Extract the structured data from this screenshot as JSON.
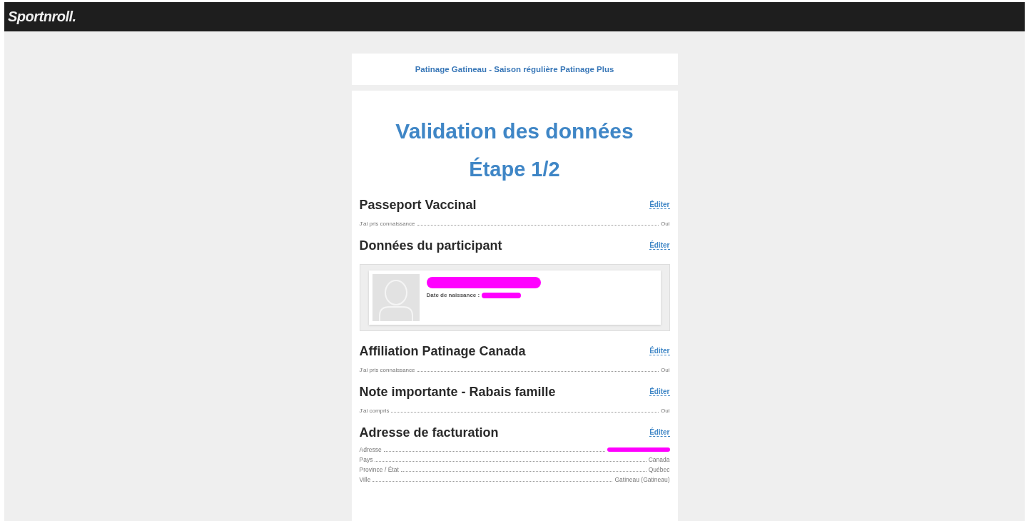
{
  "brand": "Sportnroll.",
  "event_title": "Patinage Gatineau - Saison régulière Patinage Plus",
  "heading": "Validation des données",
  "step": "Étape 1/2",
  "sections": [
    {
      "kind": "fields",
      "title": "Passeport Vaccinal",
      "edit": "Éditer",
      "rows": [
        {
          "label": "J'ai pris connaissance",
          "value": "Oui",
          "redacted": false
        }
      ]
    },
    {
      "kind": "participant",
      "title": "Données du participant",
      "edit": "Éditer",
      "participant": {
        "name_redacted": true,
        "birth_label": "Date de naissance :",
        "birth_redacted": true
      }
    },
    {
      "kind": "fields",
      "title": "Affiliation Patinage Canada",
      "edit": "Éditer",
      "rows": [
        {
          "label": "J'ai pris connaissance",
          "value": "Oui",
          "redacted": false
        }
      ]
    },
    {
      "kind": "fields",
      "title": "Note importante - Rabais famille",
      "edit": "Éditer",
      "rows": [
        {
          "label": "J'ai compris",
          "value": "Oui",
          "redacted": false
        }
      ]
    },
    {
      "kind": "address",
      "title": "Adresse de facturation",
      "edit": "Éditer",
      "rows": [
        {
          "label": "Adresse",
          "value": "",
          "redacted": true
        },
        {
          "label": "Pays",
          "value": "Canada",
          "redacted": false
        },
        {
          "label": "Province / État",
          "value": "Québec",
          "redacted": false
        },
        {
          "label": "Ville",
          "value": "Gatineau (Gatineau)",
          "redacted": false
        }
      ]
    }
  ]
}
